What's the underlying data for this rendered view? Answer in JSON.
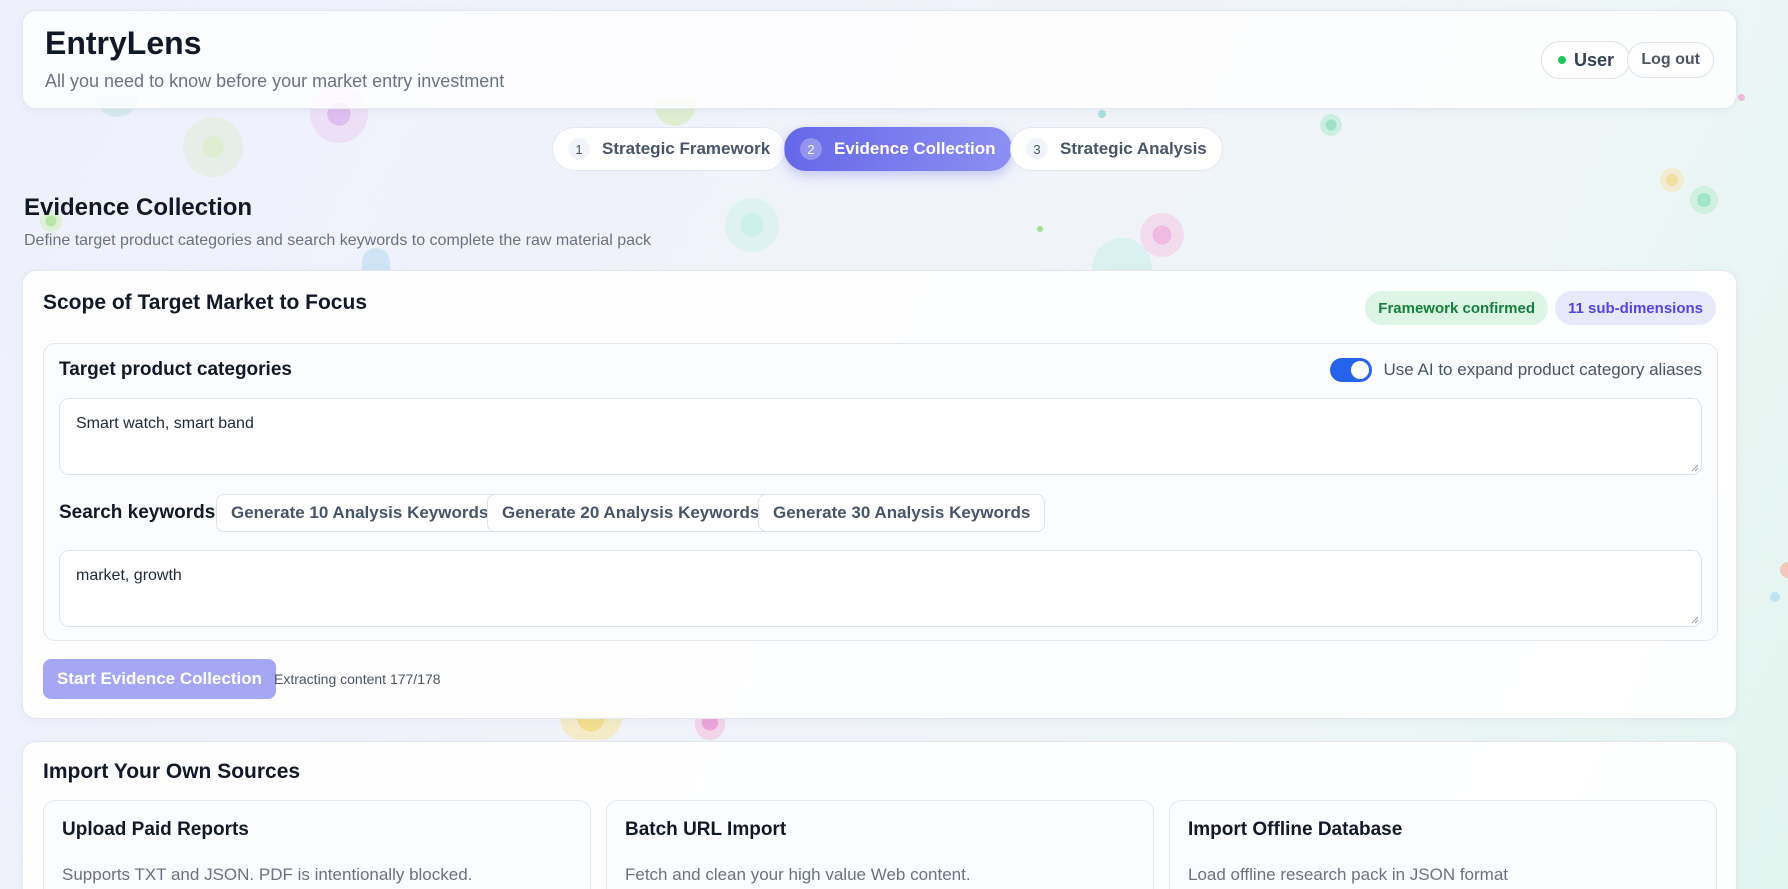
{
  "header": {
    "title": "EntryLens",
    "subtitle": "All you need to know before your market entry investment",
    "user_label": "User",
    "logout_label": "Log out"
  },
  "steps": [
    {
      "num": "1",
      "label": "Strategic Framework",
      "active": false
    },
    {
      "num": "2",
      "label": "Evidence Collection",
      "active": true
    },
    {
      "num": "3",
      "label": "Strategic Analysis",
      "active": false
    }
  ],
  "section": {
    "title": "Evidence Collection",
    "description": "Define target product categories and search keywords to complete the raw material pack"
  },
  "scope": {
    "title": "Scope of Target Market to Focus",
    "badge_confirmed": "Framework confirmed",
    "badge_subdims": "11 sub-dimensions",
    "categories_label": "Target product categories",
    "ai_toggle_label": "Use AI to expand product category aliases",
    "ai_toggle_on": true,
    "categories_value": "Smart watch, smart band",
    "keywords_label": "Search keywords",
    "gen_10": "Generate 10 Analysis Keywords",
    "gen_20": "Generate 20 Analysis Keywords",
    "gen_30": "Generate 30 Analysis Keywords",
    "keywords_value": "market, growth",
    "start_label": "Start Evidence Collection",
    "progress_text": "Extracting content 177/178"
  },
  "import": {
    "title": "Import Your Own Sources",
    "cards": [
      {
        "title": "Upload Paid Reports",
        "desc": "Supports TXT and JSON. PDF is intentionally blocked."
      },
      {
        "title": "Batch URL Import",
        "desc": "Fetch and clean your high value Web content."
      },
      {
        "title": "Import Offline Database",
        "desc": "Load offline research pack in JSON format"
      }
    ]
  },
  "colors": {
    "accent": "#6667e8",
    "toggle_on": "#2563eb",
    "success": "#15803d",
    "disabled_button": "#a5a7f4"
  }
}
